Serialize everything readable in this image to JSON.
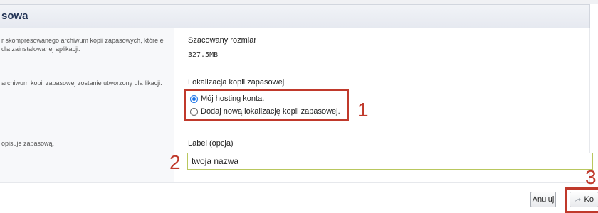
{
  "header": {
    "title": "sowa"
  },
  "rows": [
    {
      "desc": "r skompresowanego archiwum kopii zapasowych, które e dla zainstalowanej aplikacji.",
      "label": "Szacowany rozmiar",
      "value": "327.5MB"
    },
    {
      "desc": "archiwum kopii zapasowej zostanie utworzony dla likacji.",
      "label": "Lokalizacja kopii zapasowej",
      "options": [
        "Mój hosting konta.",
        "Dodaj nową lokalizację kopii zapasowej."
      ],
      "selected_index": 0
    },
    {
      "desc": "opisuje zapasową.",
      "label": "Label (opcja)",
      "input_value": "twoja nazwa"
    }
  ],
  "steps": [
    "1",
    "2",
    "3"
  ],
  "buttons": {
    "cancel": "Anuluj",
    "backup": "Ko"
  },
  "colors": {
    "accent_red": "#c0392b",
    "header_text": "#223355",
    "radio_blue": "#1a73e8"
  },
  "icons": {
    "backup_button": "share-arrow-icon"
  }
}
